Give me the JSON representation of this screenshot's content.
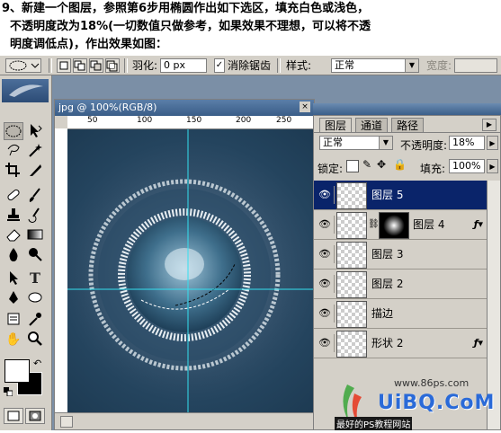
{
  "caption": {
    "line1": "9、新建一个图层，参照第6步用椭圆作出如下选区，填充白色或浅色，",
    "line2": "不透明度改为18%(一切数值只做参考，如果效果不理想，可以将不透",
    "line3": "明度调低点)，作出效果如图："
  },
  "options_bar": {
    "feather_label": "羽化:",
    "feather_value": "0 px",
    "antialias_label": "消除锯齿",
    "antialias_checked": true,
    "style_label": "样式:",
    "style_value": "正常",
    "width_label": "宽度:"
  },
  "document": {
    "title": "jpg @ 100%(RGB/8)",
    "ruler_ticks": [
      "50",
      "100",
      "150",
      "200",
      "250"
    ]
  },
  "layers_panel": {
    "tabs": [
      "图层",
      "通道",
      "路径"
    ],
    "blend_mode": "正常",
    "opacity_label": "不透明度:",
    "opacity_value": "18%",
    "lock_label": "锁定:",
    "fill_label": "填充:",
    "fill_value": "100%",
    "layers": [
      {
        "name": "图层 5",
        "selected": true,
        "has_mask": false,
        "has_fx": false
      },
      {
        "name": "图层 4",
        "selected": false,
        "has_mask": true,
        "has_fx": true
      },
      {
        "name": "图层 3",
        "selected": false,
        "has_mask": false,
        "has_fx": false
      },
      {
        "name": "图层 2",
        "selected": false,
        "has_mask": false,
        "has_fx": false
      },
      {
        "name": "描边",
        "selected": false,
        "has_mask": false,
        "has_fx": false
      },
      {
        "name": "形状 2",
        "selected": false,
        "has_mask": false,
        "has_fx": true
      }
    ]
  },
  "watermark": {
    "logo_text": "UiBQ.CoM",
    "partial_url": "www.86ps.com",
    "bottom_text": "最好的PS教程网站"
  },
  "colors": {
    "accent_selection": "#0a246a",
    "canvas_bg": "#24445e",
    "guide": "#34e0f0"
  }
}
